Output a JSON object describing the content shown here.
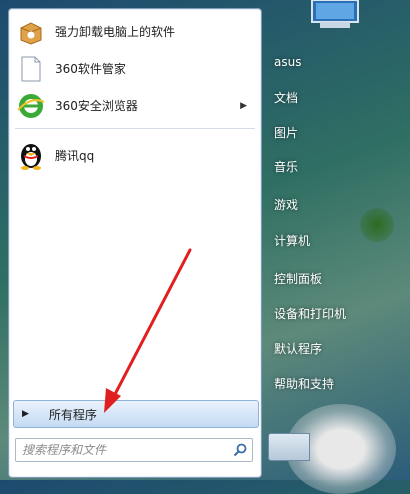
{
  "pinned_programs": [
    {
      "label": "强力卸载电脑上的软件",
      "icon": "uninstall-box-icon",
      "has_submenu": false
    },
    {
      "label": "360软件管家",
      "icon": "blank-document-icon",
      "has_submenu": false
    },
    {
      "label": "360安全浏览器",
      "icon": "360-browser-icon",
      "has_submenu": true
    }
  ],
  "recent_programs": [
    {
      "label": "腾讯qq",
      "icon": "qq-penguin-icon"
    }
  ],
  "all_programs_label": "所有程序",
  "search": {
    "placeholder": "搜索程序和文件"
  },
  "right_pane": {
    "items": [
      "asus",
      "文档",
      "图片",
      "音乐",
      "游戏",
      "计算机",
      "控制面板",
      "设备和打印机",
      "默认程序",
      "帮助和支持"
    ]
  },
  "colors": {
    "annotation_arrow": "#e02020",
    "all_programs_highlight": "#c4daf3"
  }
}
